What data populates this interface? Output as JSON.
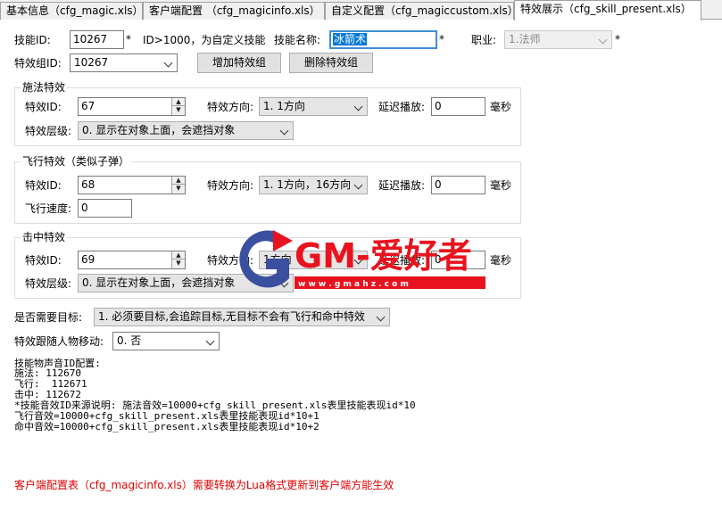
{
  "tabs": [
    {
      "label": "基本信息（cfg_magic.xls）"
    },
    {
      "label": "客户端配置 （cfg_magicinfo.xls）"
    },
    {
      "label": "自定义配置（cfg_magiccustom.xls）"
    },
    {
      "label": "特效展示（cfg_skill_present.xls）"
    }
  ],
  "top": {
    "skill_id_label": "技能ID:",
    "skill_id_value": "10267",
    "star": "*",
    "skill_id_hint": "ID>1000，为自定义技能",
    "skill_name_label": "技能名称:",
    "skill_name_value": "冰箭术",
    "job_label": "职业:",
    "job_value": "1.法师",
    "effect_group_label": "特效组ID:",
    "effect_group_value": "10267",
    "add_group_button": "增加特效组",
    "delete_group_button": "删除特效组"
  },
  "cast": {
    "title": "施法特效",
    "effect_id_label": "特效ID:",
    "effect_id_value": "67",
    "direction_label": "特效方向:",
    "direction_value": "1. 1方向",
    "delay_label": "延迟播放:",
    "delay_value": "0",
    "ms_label": "毫秒",
    "layer_label": "特效层级:",
    "layer_value": "0. 显示在对象上面，会遮挡对象"
  },
  "fly": {
    "title": "飞行特效（类似子弹）",
    "effect_id_label": "特效ID:",
    "effect_id_value": "68",
    "direction_label": "特效方向:",
    "direction_value": "1. 1方向，16方向",
    "delay_label": "延迟播放:",
    "delay_value": "0",
    "ms_label": "毫秒",
    "speed_label": "飞行速度:",
    "speed_value": "0"
  },
  "hit": {
    "title": "击中特效",
    "effect_id_label": "特效ID:",
    "effect_id_value": "69",
    "direction_label": "特效方向:",
    "direction_value": "1方向",
    "delay_label": "延迟播放:",
    "delay_value": "0",
    "ms_label": "毫秒",
    "layer_label": "特效层级:",
    "layer_value": "0. 显示在对象上面，会遮挡对象"
  },
  "target_label": "是否需要目标:",
  "target_value": "1. 必须要目标,会追踪目标,无目标不会有飞行和命中特效",
  "follow_label": "特效跟随人物移动:",
  "follow_value": "0. 否",
  "sound_lines": [
    "技能物声音ID配置:",
    "施法: 112670",
    "飞行:  112671",
    "击中: 112672",
    "*技能音效ID来源说明: 施法音效=10000+cfg_skill_present.xls表里技能表现id*10",
    "飞行音效=10000+cfg_skill_present.xls表里技能表现id*10+1",
    "命中音效=10000+cfg_skill_present.xls表里技能表现id*10+2"
  ],
  "footer_note": "客户端配置表（cfg_magicinfo.xls）需要转换为Lua格式更新到客户端方能生效",
  "watermark": {
    "text": "GM-爱好者",
    "url": "w w w . g m a h z . c o m"
  },
  "colors": {
    "selection": "#0078d7",
    "note_red": "#e00000",
    "watermark_red": "#e8131e",
    "watermark_blue": "#3b4fa0"
  }
}
